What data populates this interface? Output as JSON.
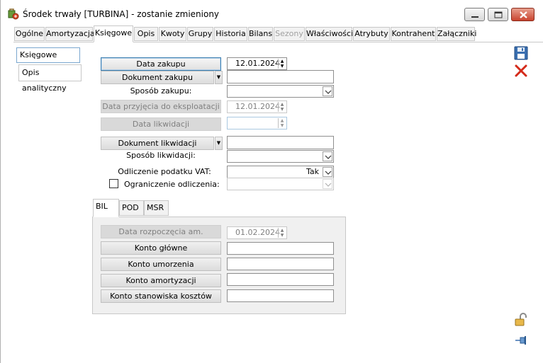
{
  "window": {
    "title": "Środek trwały [TURBINA] - zostanie zmieniony"
  },
  "tabs": [
    {
      "label": "Ogólne"
    },
    {
      "label": "Amortyzacja"
    },
    {
      "label": "Księgowe"
    },
    {
      "label": "Opis"
    },
    {
      "label": "Kwoty"
    },
    {
      "label": "Grupy"
    },
    {
      "label": "Historia"
    },
    {
      "label": "Bilans"
    },
    {
      "label": "Sezony"
    },
    {
      "label": "Właściwości"
    },
    {
      "label": "Atrybuty"
    },
    {
      "label": "Kontrahent"
    },
    {
      "label": "Załączniki"
    }
  ],
  "left_list": [
    {
      "label": "Księgowe"
    },
    {
      "label": "Opis analityczny"
    }
  ],
  "form": {
    "data_zakupu_label": "Data zakupu",
    "data_zakupu_value": "12.01.2024",
    "dokument_zakupu_label": "Dokument zakupu",
    "dokument_zakupu_value": "",
    "sposob_zakupu_label": "Sposób zakupu:",
    "sposob_zakupu_value": "",
    "data_przyjecia_label": "Data przyjęcia do eksploatacji",
    "data_przyjecia_value": "12.01.2024",
    "data_likwidacji_label": "Data likwidacji",
    "data_likwidacji_value": "",
    "dokument_likwidacji_label": "Dokument likwidacji",
    "dokument_likwidacji_value": "",
    "sposob_likwidacji_label": "Sposób likwidacji:",
    "sposob_likwidacji_value": "",
    "odliczenie_vat_label": "Odliczenie podatku VAT:",
    "odliczenie_vat_value": "Tak",
    "ograniczenie_label": "Ograniczenie odliczenia:",
    "ograniczenie_value": ""
  },
  "inner_tabs": [
    {
      "label": "BIL"
    },
    {
      "label": "POD"
    },
    {
      "label": "MSR"
    }
  ],
  "bil": {
    "data_rozpoczecia_label": "Data rozpoczęcia am.",
    "data_rozpoczecia_value": "01.02.2024",
    "konto_glowne_label": "Konto główne",
    "konto_glowne_value": "",
    "konto_umorzenia_label": "Konto umorzenia",
    "konto_umorzenia_value": "",
    "konto_amortyzacji_label": "Konto amortyzacji",
    "konto_amortyzacji_value": "",
    "konto_stanowiska_label": "Konto stanowiska kosztów",
    "konto_stanowiska_value": ""
  },
  "colors": {
    "accent": "#3c7fb1",
    "close_red": "#c9432e",
    "panel_bg": "#f0f0f0"
  }
}
